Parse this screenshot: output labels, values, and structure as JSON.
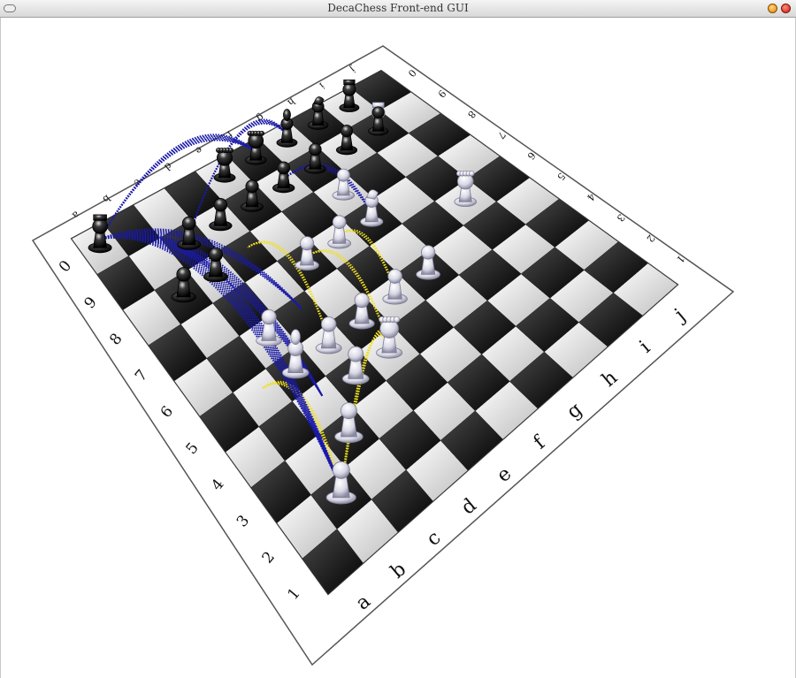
{
  "window": {
    "title": "DecaChess Front-end GUI"
  },
  "board": {
    "files": [
      "a",
      "b",
      "c",
      "d",
      "e",
      "f",
      "g",
      "h",
      "i",
      "j"
    ],
    "ranks": [
      "1",
      "2",
      "3",
      "4",
      "5",
      "6",
      "7",
      "8",
      "9",
      "0"
    ],
    "white_pieces": [
      {
        "type": "pawn",
        "square": "b2"
      },
      {
        "type": "pawn",
        "square": "c3"
      },
      {
        "type": "pawn",
        "square": "d4"
      },
      {
        "type": "pawn",
        "square": "d5"
      },
      {
        "type": "pawn",
        "square": "e5"
      },
      {
        "type": "pawn",
        "square": "f7"
      },
      {
        "type": "pawn",
        "square": "g8"
      },
      {
        "type": "pawn",
        "square": "h9"
      },
      {
        "type": "pawn",
        "square": "f9"
      },
      {
        "type": "pawn",
        "square": "e7"
      },
      {
        "type": "pawn",
        "square": "c6"
      },
      {
        "type": "pawn",
        "square": "g5"
      },
      {
        "type": "pawn",
        "square": "f5"
      },
      {
        "type": "queen",
        "square": "e4"
      },
      {
        "type": "bishop",
        "square": "c5"
      },
      {
        "type": "rook",
        "square": "i9"
      },
      {
        "type": "king",
        "square": "i6"
      },
      {
        "type": "knight",
        "square": "g7"
      }
    ],
    "black_pieces": [
      {
        "type": "rook",
        "square": "a0"
      },
      {
        "type": "pawn",
        "square": "b8"
      },
      {
        "type": "pawn",
        "square": "c9"
      },
      {
        "type": "pawn",
        "square": "c8"
      },
      {
        "type": "pawn",
        "square": "d9"
      },
      {
        "type": "pawn",
        "square": "e9"
      },
      {
        "type": "pawn",
        "square": "f9"
      },
      {
        "type": "bishop",
        "square": "g0"
      },
      {
        "type": "king",
        "square": "e0"
      },
      {
        "type": "queen",
        "square": "f0"
      },
      {
        "type": "knight",
        "square": "h0"
      },
      {
        "type": "rook",
        "square": "i0"
      },
      {
        "type": "pawn",
        "square": "g9"
      },
      {
        "type": "pawn",
        "square": "h9"
      },
      {
        "type": "pawn",
        "square": "i9"
      }
    ]
  },
  "colors": {
    "board_dark": "#111111",
    "board_light": "#f2f2f2",
    "border": "#ffffff",
    "white_move_arc": "#f0e020",
    "black_move_arc": "#1a1aa8"
  }
}
